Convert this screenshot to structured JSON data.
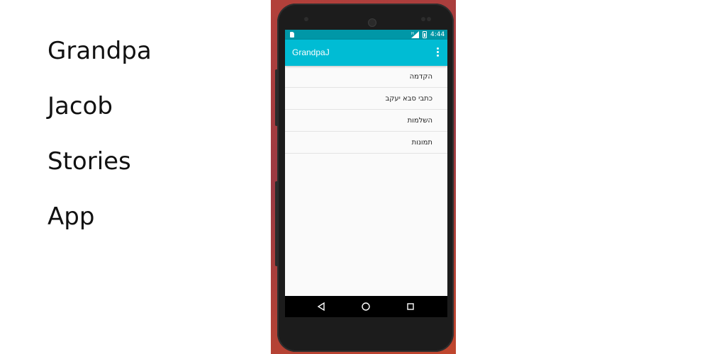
{
  "promo": {
    "words": [
      "Grandpa",
      "Jacob",
      "Stories",
      "App"
    ]
  },
  "status_bar": {
    "time": "4:44",
    "icons": [
      "sd-card-icon",
      "signal-icon",
      "battery-charging-icon"
    ]
  },
  "app_bar": {
    "title": "GrandpaJ",
    "overflow_icon": "more-vert-icon"
  },
  "menu": {
    "items": [
      {
        "label": "הקדמה"
      },
      {
        "label": "כתבי סבא יעקב"
      },
      {
        "label": "השלמות"
      },
      {
        "label": "תמונות"
      }
    ]
  },
  "nav_bar": {
    "buttons": [
      "back-icon",
      "home-icon",
      "recents-icon"
    ]
  },
  "colors": {
    "app_bar": "#00bcd4",
    "status_bar": "#0097a7",
    "list_background": "#fafafa",
    "nav_bar": "#000000",
    "background_accent": "#b3403a"
  }
}
